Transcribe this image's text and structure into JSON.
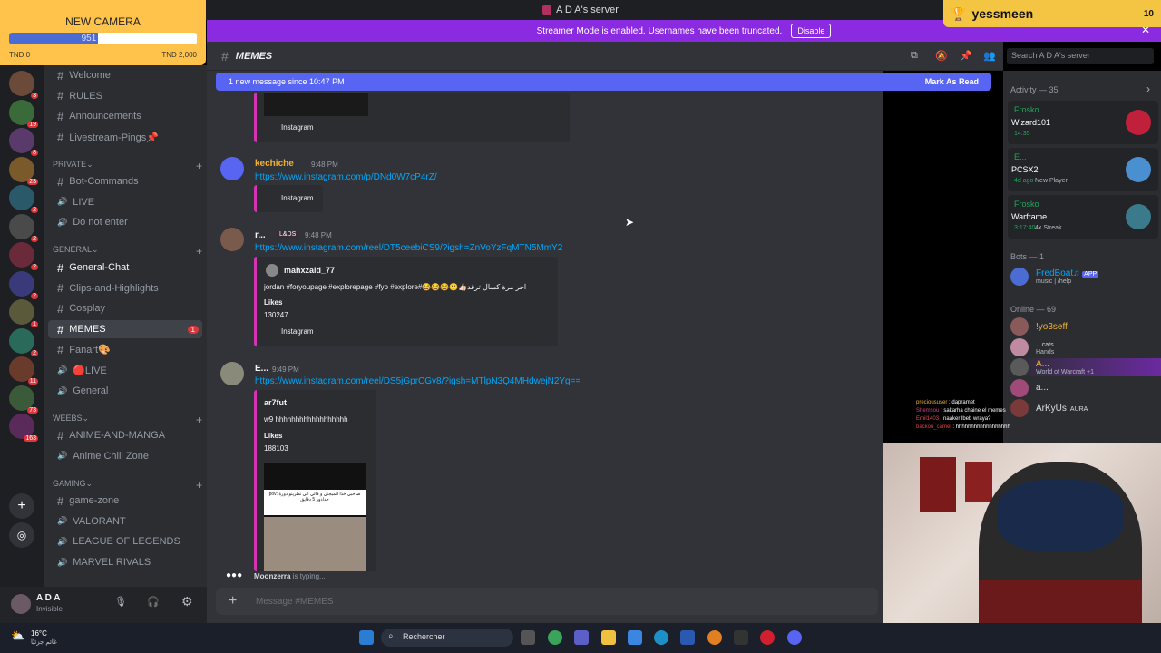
{
  "window": {
    "title": "A D A's server"
  },
  "streamer_banner": {
    "text": "Streamer Mode is enabled. Usernames have been truncated.",
    "button": "Disable"
  },
  "donation_widget": {
    "title": "NEW CAMERA",
    "raised": "951",
    "progress": 0.475,
    "min": "TND 0",
    "max": "TND 2,000"
  },
  "follower_widget": {
    "name": "yessmeen",
    "count": "10"
  },
  "server_badges": [
    "3",
    "19",
    "8",
    "23",
    "2",
    "2",
    "2",
    "2",
    "1",
    "2",
    "11",
    "73",
    "163"
  ],
  "sidebar": {
    "channels": [
      {
        "name": "Welcome",
        "icon": "hash-icon"
      },
      {
        "name": "RULES",
        "icon": "hash-icon"
      },
      {
        "name": "Announcements",
        "icon": "hash-icon"
      },
      {
        "name": "Livestream-Pings📌",
        "icon": "hash-icon"
      }
    ],
    "private_label": "PRIVATE",
    "private": [
      {
        "name": "Bot-Commands",
        "icon": "hash-icon"
      },
      {
        "name": "LIVE",
        "icon": "speaker-icon"
      },
      {
        "name": "Do not enter",
        "icon": "speaker-icon"
      }
    ],
    "general_label": "GENERAL",
    "general": [
      {
        "name": "General-Chat",
        "icon": "hash-icon"
      },
      {
        "name": "Clips-and-Highlights",
        "icon": "hash-icon"
      },
      {
        "name": "Cosplay",
        "icon": "hash-icon"
      },
      {
        "name": "MEMES",
        "icon": "hash-icon",
        "badge": "1"
      },
      {
        "name": "Fanart🎨",
        "icon": "hash-icon"
      },
      {
        "name": "🔴LIVE",
        "icon": "speaker-icon"
      },
      {
        "name": "General",
        "icon": "speaker-icon"
      }
    ],
    "weebs_label": "WEEBS",
    "weebs": [
      {
        "name": "ANIME-AND-MANGA",
        "icon": "hash-icon"
      },
      {
        "name": "Anime Chill Zone",
        "icon": "speaker-icon"
      }
    ],
    "gaming_label": "GAMING",
    "gaming": [
      {
        "name": "game-zone",
        "icon": "hash-icon"
      },
      {
        "name": "VALORANT",
        "icon": "speaker-icon"
      },
      {
        "name": "LEAGUE OF LEGENDS",
        "icon": "speaker-icon"
      },
      {
        "name": "MARVEL RIVALS",
        "icon": "speaker-icon"
      }
    ]
  },
  "user": {
    "name": "A D A",
    "status": "Invisible"
  },
  "channel": {
    "name": "MEMES",
    "search_placeholder": "Search A D A's server"
  },
  "new_messages": {
    "text": "1 new message since 10:47 PM",
    "action": "Mark As Read"
  },
  "messages": [
    {
      "embed_label": "Instagram"
    },
    {
      "author": "kechiche",
      "time": "9:48 PM",
      "link": "https://www.instagram.com/p/DNd0W7cP4rZ/",
      "embed_label": "Instagram"
    },
    {
      "author": "r...",
      "tag": "L&DS",
      "time": "9:48 PM",
      "link": "https://www.instagram.com/reel/DT5ceebiCS9/?igsh=ZnVoYzFqMTN5MmY2",
      "embed_author": "mahxzaid_77",
      "embed_text": "jordan #foryoupage #explorepage #fyp #explore#😂😂😂🙂👍🏻اخر مرة كسال ترقد",
      "likes_label": "Likes",
      "likes": "130247",
      "embed_label": "Instagram"
    },
    {
      "author": "E...",
      "time": "9:49 PM",
      "link": "https://www.instagram.com/reel/DS5jGprCGv8/?igsh=MTlpN3Q4MHdwejN2Yg==",
      "embed_author": "ar7fut",
      "embed_text": "w9 hhhhhhhhhhhhhhhhhh",
      "likes_label": "Likes",
      "likes": "188103",
      "thumb_text": "pov: صاحبي خذا الميجني و قالي اني نطرينو دورة حدادور 5 دقايق"
    }
  ],
  "typing": {
    "user": "Moonzerra",
    "text": "is typing..."
  },
  "composer": {
    "placeholder": "Message #MEMES"
  },
  "members": {
    "activity_label": "Activity — 35",
    "activities": [
      {
        "name": "Frosko",
        "game": "Wizard101",
        "stat": "14:35",
        "extra": ""
      },
      {
        "name": "E...",
        "game": "PCSX2",
        "stat": "4d ago",
        "extra": "New Player"
      },
      {
        "name": "Frosko",
        "game": "Warframe",
        "stat": "3:17:40",
        "extra": "4x Streak"
      }
    ],
    "bots_label": "Bots — 1",
    "bot": {
      "name": "FredBoat♫",
      "tag": "APP",
      "sub": "music | /help"
    },
    "online_label": "Online — 69",
    "online": [
      {
        "name": "!yo3seff",
        "sub": ""
      },
      {
        "name": ".",
        "sub": "Hands",
        "tag": "cats"
      },
      {
        "name": "A...",
        "sub": "World of Warcraft +1"
      },
      {
        "name": "a...",
        "sub": ""
      },
      {
        "name": "ArKyUs",
        "sub": "",
        "tag": "AURA"
      }
    ]
  },
  "stream_chat": [
    {
      "user": "precioususer",
      "msg": "dapramet"
    },
    {
      "user": "Shemsou",
      "msg": "sakarha chaine el memes"
    },
    {
      "user": "Emil1403",
      "msg": "naaker lbeb wraya?"
    },
    {
      "user": "backou_camel",
      "msg": "hhhhhhhhhhhhhhhhhh"
    }
  ],
  "taskbar": {
    "weather_temp": "16°C",
    "weather_desc": "غائم جزئيًا",
    "search": "Rechercher"
  },
  "colors": {
    "accent": "#5865f2",
    "streamer": "#8a2be2",
    "embed_border": "#d633b3",
    "link": "#00a8fc"
  }
}
